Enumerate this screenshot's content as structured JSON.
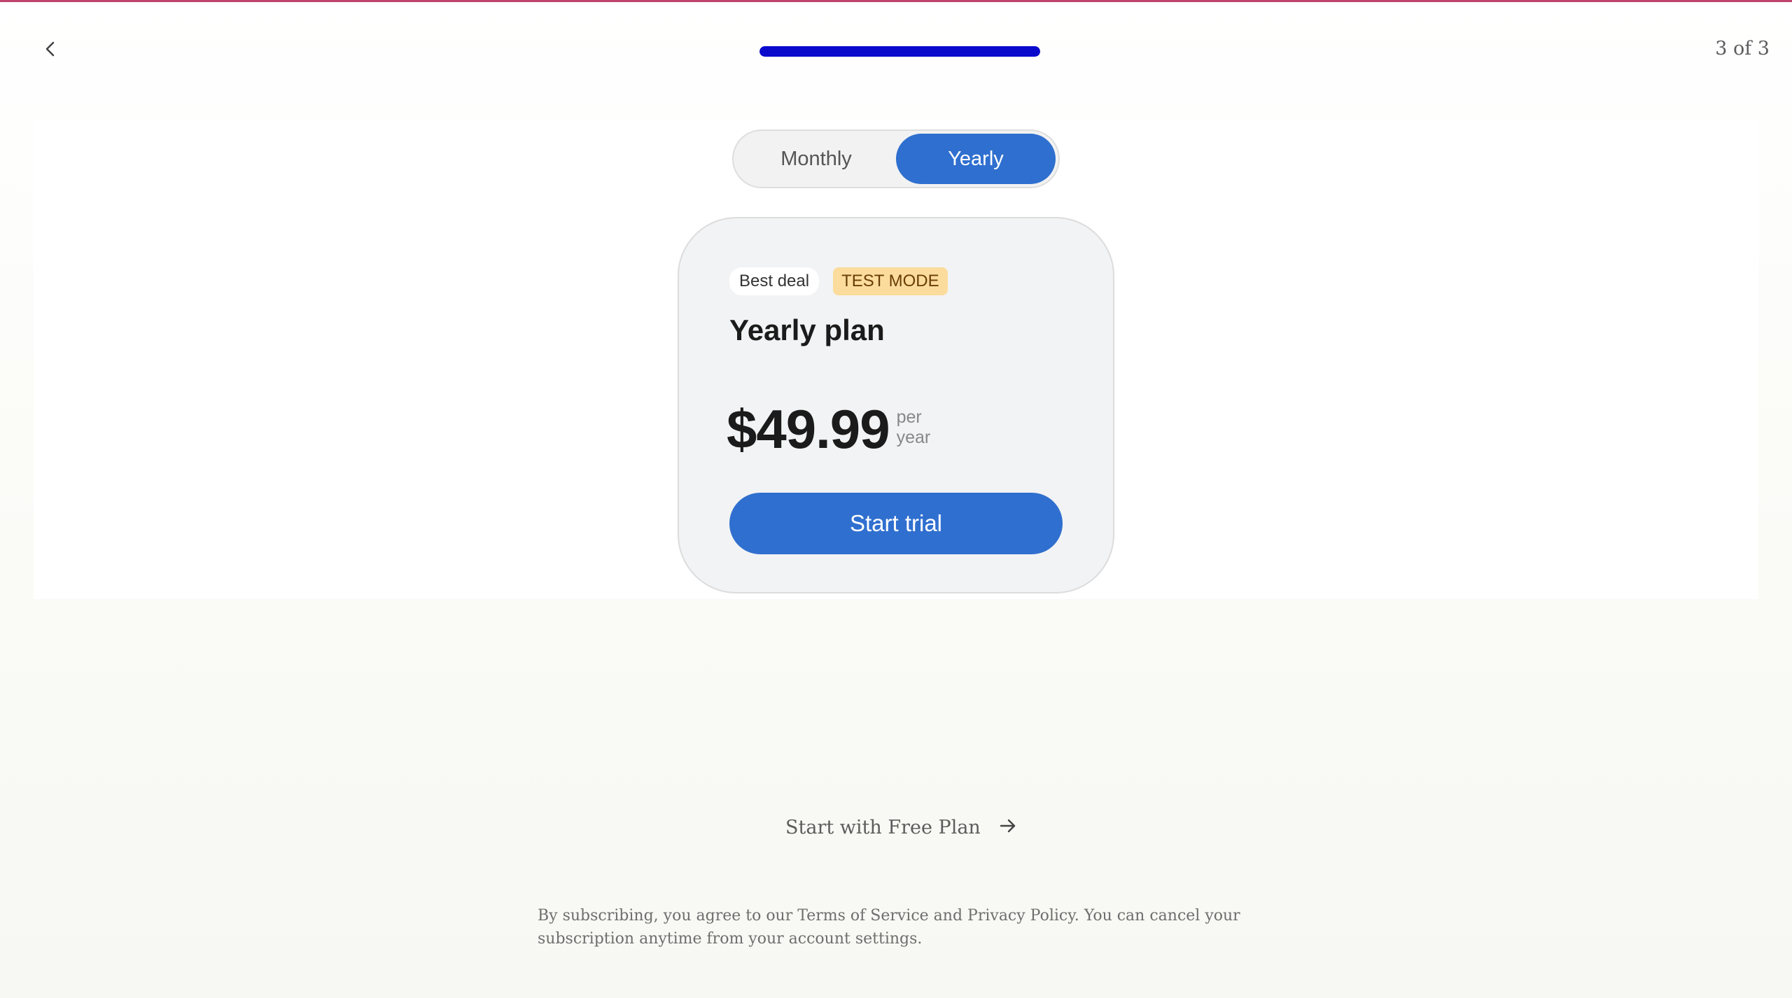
{
  "header": {
    "back_icon": "chevron-left-icon",
    "step_counter": "3 of 3",
    "progress_fraction": 1.0
  },
  "billing_toggle": {
    "options": [
      "Monthly",
      "Yearly"
    ],
    "selected": "Yearly"
  },
  "plan_card": {
    "badges": [
      "Best deal",
      "TEST MODE"
    ],
    "title": "Yearly plan",
    "price": "$49.99",
    "price_unit_line1": "per",
    "price_unit_line2": "year",
    "cta_label": "Start trial"
  },
  "footer": {
    "free_plan_label": "Start with Free Plan",
    "free_plan_icon": "arrow-right-icon",
    "disclaimer": "By subscribing, you agree to our Terms of Service and Privacy Policy. You can cancel your subscription anytime from your account settings."
  },
  "colors": {
    "accent_blue": "#2f6fcf",
    "progress_blue": "#0a0acc",
    "top_accent": "#c0436b",
    "test_badge_bg": "#fbdc9c"
  }
}
